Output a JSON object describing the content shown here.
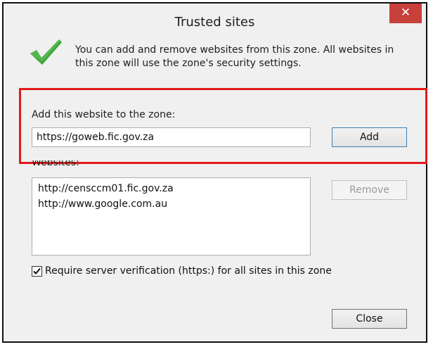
{
  "window": {
    "title": "Trusted sites",
    "close_glyph": "✕"
  },
  "intro": {
    "text": "You can add and remove websites from this zone. All websites in this zone will use the zone's security settings.",
    "icon": "green-checkmark-icon"
  },
  "add_section": {
    "label": "Add this website to the zone:",
    "url_value": "https://goweb.fic.gov.za",
    "add_label": "Add",
    "highlight_color": "#e21a1a"
  },
  "websites": {
    "label": "Websites:",
    "items": [
      "http://censccm01.fic.gov.za",
      "http://www.google.com.au"
    ],
    "remove_label": "Remove"
  },
  "require_https": {
    "checked": true,
    "label": "Require server verification (https:) for all sites in this zone"
  },
  "footer": {
    "close_label": "Close"
  },
  "colors": {
    "close_button": "#c7403a",
    "check_green": "#3ea33a",
    "dialog_bg": "#f0f0f0"
  }
}
